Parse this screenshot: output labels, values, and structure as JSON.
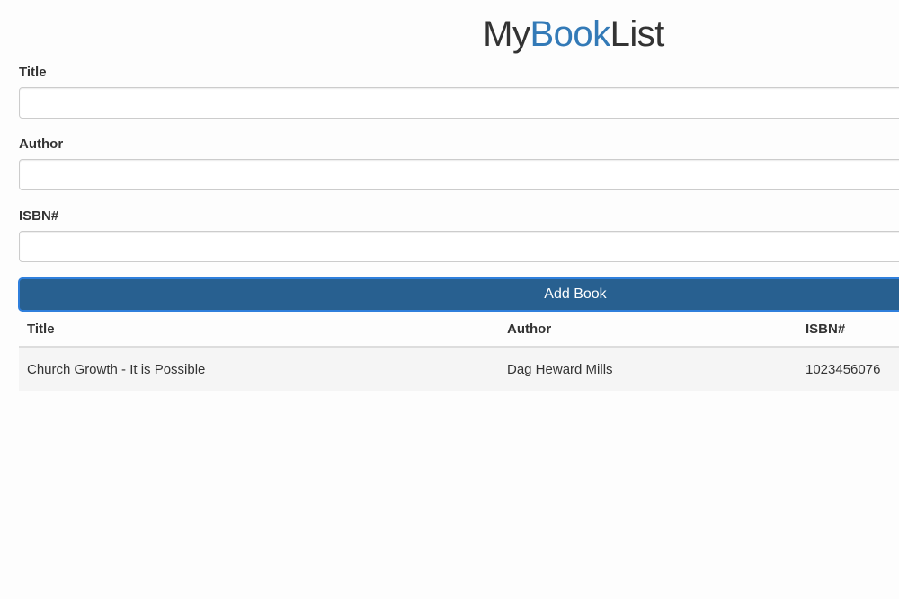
{
  "header": {
    "title_part1": "My",
    "title_part2": "Book",
    "title_part3": "List"
  },
  "form": {
    "title_label": "Title",
    "title_value": "",
    "author_label": "Author",
    "author_value": "",
    "isbn_label": "ISBN#",
    "isbn_value": "",
    "submit_label": "Add Book"
  },
  "table": {
    "columns": [
      "Title",
      "Author",
      "ISBN#"
    ],
    "rows": [
      [
        "Church Growth - It is Possible",
        "Dag Heward Mills",
        "1023456076"
      ]
    ]
  },
  "colors": {
    "accent": "#337ab7",
    "button": "#286090"
  }
}
